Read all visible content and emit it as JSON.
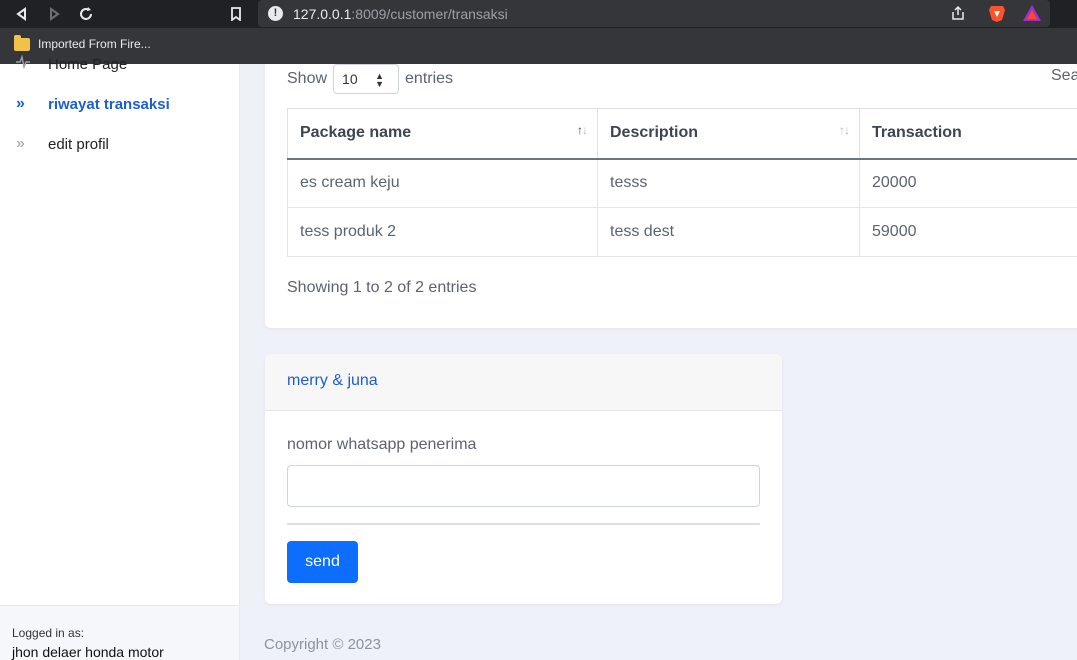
{
  "browser": {
    "url_host": "127.0.0.1",
    "url_rest": ":8009/customer/transaksi",
    "bookmark": "Imported From Fire..."
  },
  "sidebar": {
    "items": [
      {
        "label": "Home Page"
      },
      {
        "label": "riwayat transaksi"
      },
      {
        "label": "edit profil"
      }
    ],
    "footer_label": "Logged in as:",
    "footer_user": "jhon delaer honda motor"
  },
  "table_controls": {
    "show_label": "Show",
    "entries_value": "10",
    "entries_label": "entries",
    "search_label": "Search:"
  },
  "table": {
    "headers": [
      "Package name",
      "Description",
      "Transaction"
    ],
    "rows": [
      [
        "es cream keju",
        "tesss",
        "20000"
      ],
      [
        "tess produk 2",
        "tess dest",
        "59000"
      ]
    ],
    "info": "Showing 1 to 2 of 2 entries"
  },
  "message_card": {
    "title": "merry & juna",
    "field_label": "nomor whatsapp penerima",
    "field_value": "",
    "send_label": "send"
  },
  "footer": {
    "copyright": "Copyright © 2023"
  }
}
